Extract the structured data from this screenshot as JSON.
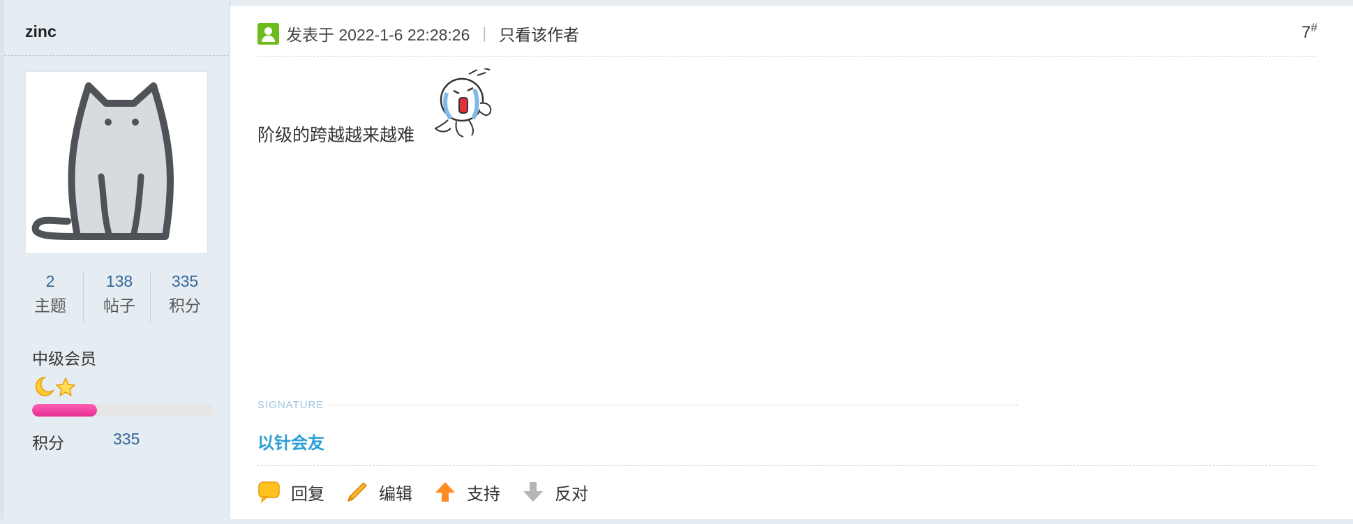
{
  "author": {
    "username": "zinc",
    "stats": [
      {
        "value": "2",
        "label": "主题"
      },
      {
        "value": "138",
        "label": "帖子"
      },
      {
        "value": "335",
        "label": "积分"
      }
    ],
    "group": "中级会员",
    "level_progress": 0.36,
    "score_label": "积分",
    "score_value": "335"
  },
  "post": {
    "time": "发表于 2022-1-6 22:28:26",
    "only_author": "只看该作者",
    "floor": "7",
    "floor_mark": "#",
    "content": "阶级的跨越越来越难",
    "signature_tag": "SIGNATURE",
    "signature": "以针会友"
  },
  "actions": {
    "reply": "回复",
    "edit": "编辑",
    "support": "支持",
    "oppose": "反对"
  },
  "colors": {
    "sidebar_bg": "#e5edf2",
    "link_blue": "#336699",
    "signature_blue": "#2a9fd6",
    "online_green": "#6ebb1e",
    "progress_pink": "#e52e94"
  }
}
